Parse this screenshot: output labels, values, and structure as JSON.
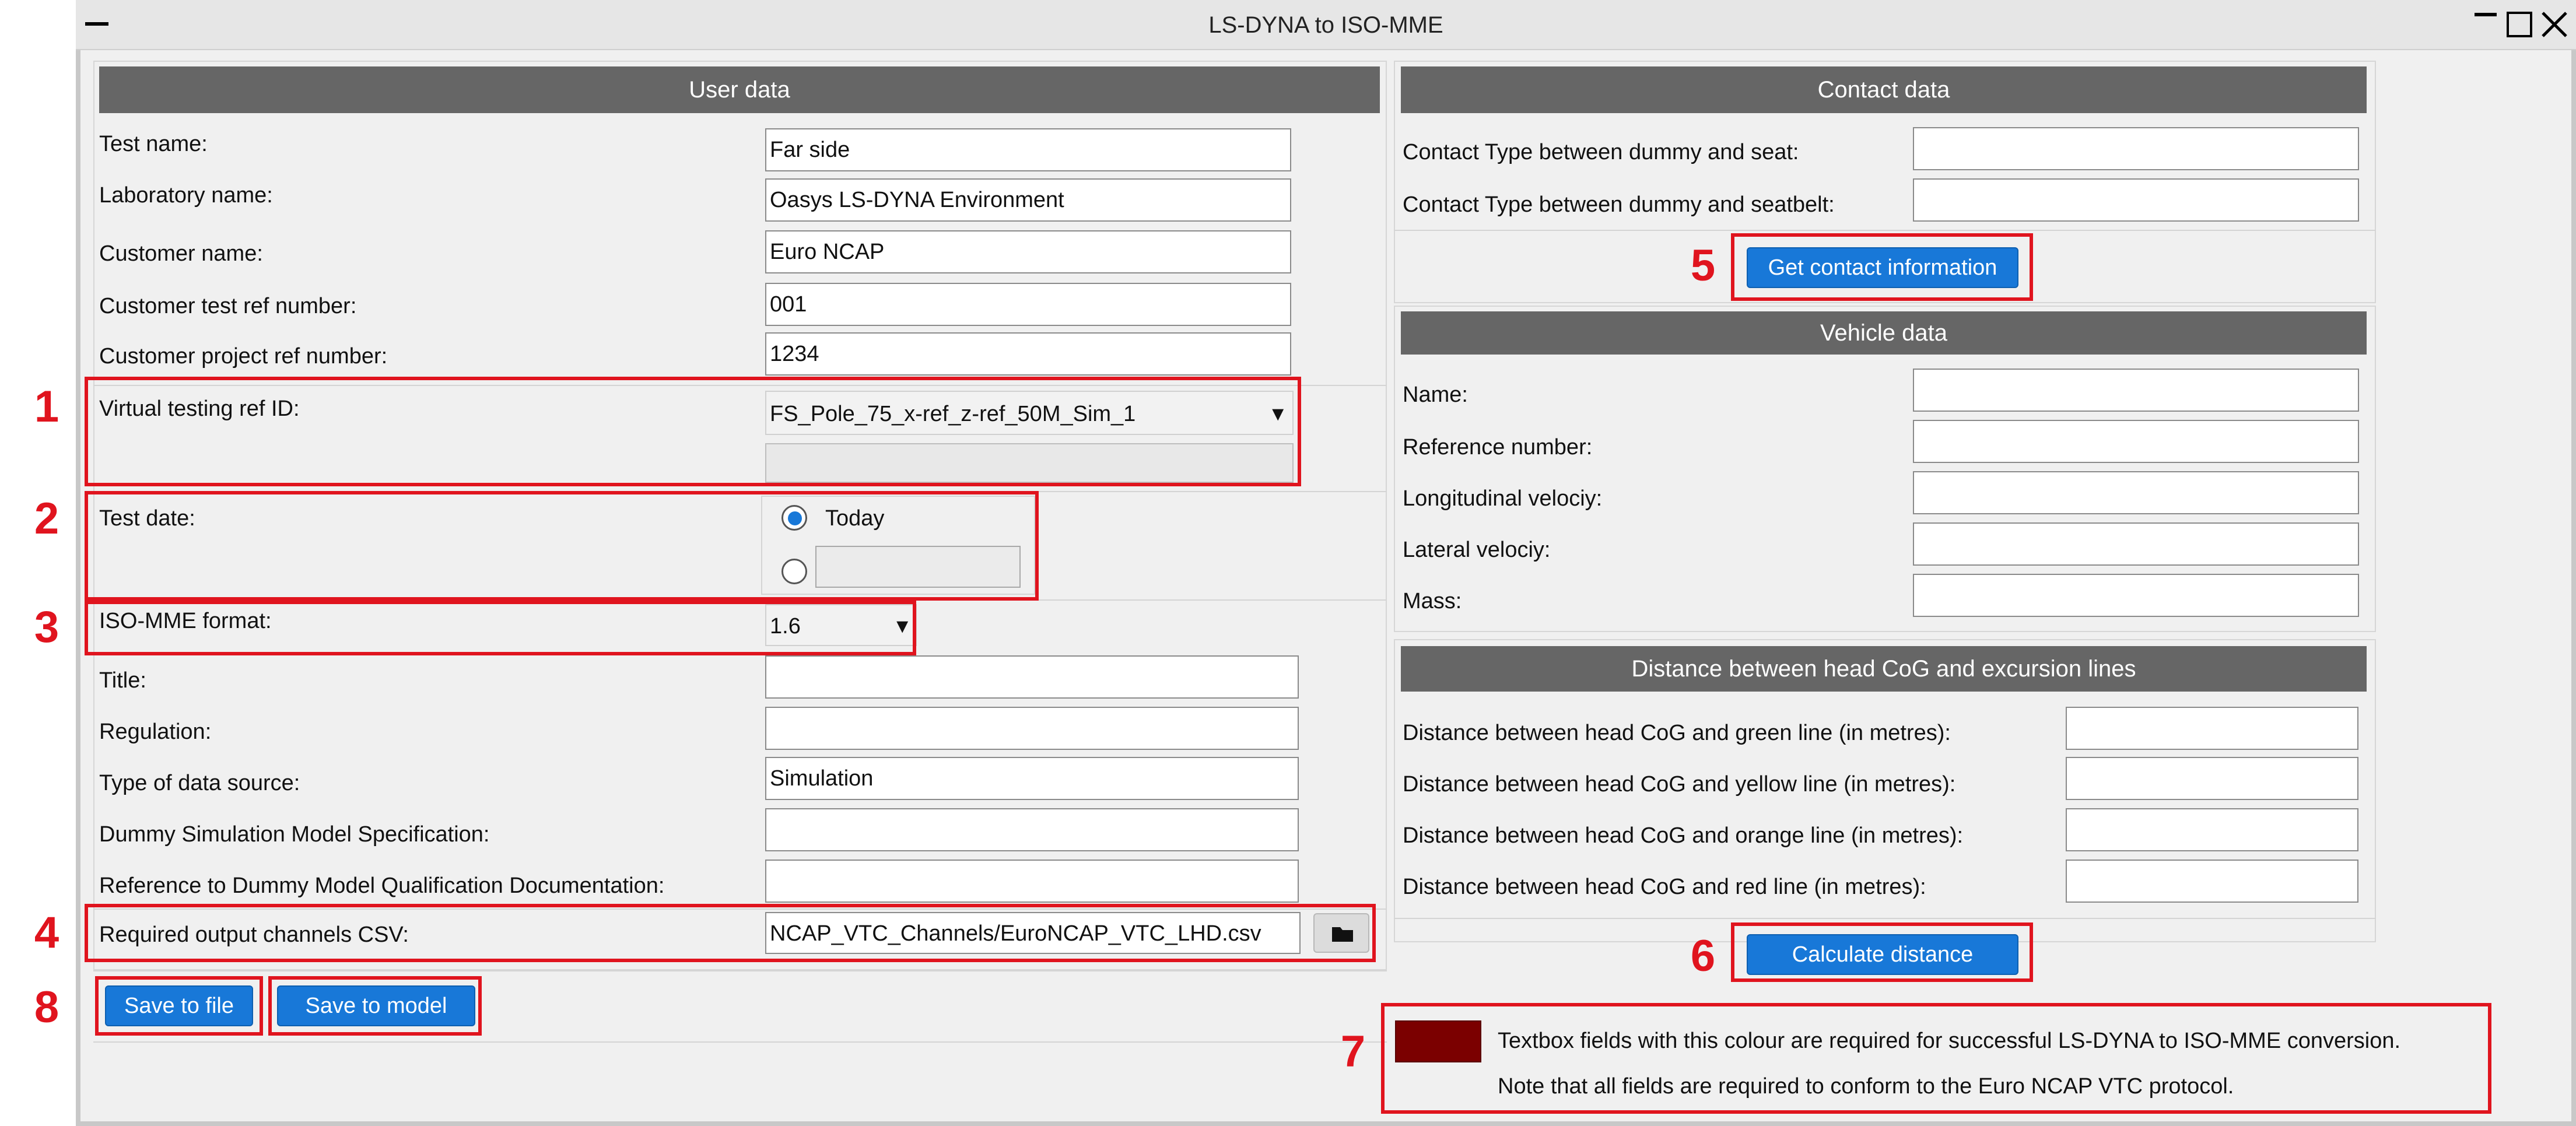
{
  "window": {
    "title": "LS-DYNA to ISO-MME"
  },
  "colors": {
    "header_bg": "#666666",
    "button_bg": "#1878d8",
    "annotation_red": "#e0141e",
    "required_swatch": "#7b0000"
  },
  "user_data": {
    "header": "User data",
    "fields": [
      {
        "label": "Test name:",
        "value": "Far side"
      },
      {
        "label": "Laboratory name:",
        "value": "Oasys LS-DYNA Environment"
      },
      {
        "label": "Customer name:",
        "value": "Euro NCAP"
      },
      {
        "label": "Customer test ref number:",
        "value": "001"
      },
      {
        "label": "Customer project ref number:",
        "value": "1234"
      }
    ],
    "virtual_testing": {
      "label": "Virtual testing ref ID:",
      "value": "FS_Pole_75_x-ref_z-ref_50M_Sim_1",
      "secondary_value": ""
    },
    "test_date": {
      "label": "Test date:",
      "today_label": "Today",
      "today_selected": true,
      "custom_value": ""
    },
    "iso_format": {
      "label": "ISO-MME format:",
      "value": "1.6"
    },
    "fields2": [
      {
        "label": "Title:",
        "value": ""
      },
      {
        "label": "Regulation:",
        "value": ""
      },
      {
        "label": "Type of data source:",
        "value": "Simulation"
      },
      {
        "label": "Dummy Simulation Model Specification:",
        "value": ""
      },
      {
        "label": "Reference to Dummy Model Qualification Documentation:",
        "value": ""
      }
    ],
    "output_channels": {
      "label": "Required output channels CSV:",
      "value": "NCAP_VTC_Channels/EuroNCAP_VTC_LHD.csv"
    },
    "save_file_label": "Save to file",
    "save_model_label": "Save to model"
  },
  "contact_data": {
    "header": "Contact data",
    "fields": [
      {
        "label": "Contact Type between dummy and seat:",
        "value": ""
      },
      {
        "label": "Contact Type between dummy and seatbelt:",
        "value": ""
      }
    ],
    "button_label": "Get contact information"
  },
  "vehicle_data": {
    "header": "Vehicle data",
    "fields": [
      {
        "label": "Name:",
        "value": ""
      },
      {
        "label": "Reference number:",
        "value": ""
      },
      {
        "label": "Longitudinal velociy:",
        "value": ""
      },
      {
        "label": "Lateral velociy:",
        "value": ""
      },
      {
        "label": "Mass:",
        "value": ""
      }
    ]
  },
  "distance": {
    "header": "Distance between head CoG and excursion lines",
    "fields": [
      {
        "label": "Distance between head CoG and green line (in metres):",
        "value": ""
      },
      {
        "label": "Distance between head CoG and yellow line (in metres):",
        "value": ""
      },
      {
        "label": "Distance between head CoG and orange line (in metres):",
        "value": ""
      },
      {
        "label": "Distance between head CoG and red line (in metres):",
        "value": ""
      }
    ],
    "button_label": "Calculate distance"
  },
  "note": {
    "line1": "Textbox fields with this colour are required for successful LS-DYNA to ISO-MME conversion.",
    "line2": "Note that all fields are required to conform to the Euro NCAP VTC protocol."
  },
  "annotations": [
    "1",
    "2",
    "3",
    "4",
    "5",
    "6",
    "7",
    "8"
  ]
}
